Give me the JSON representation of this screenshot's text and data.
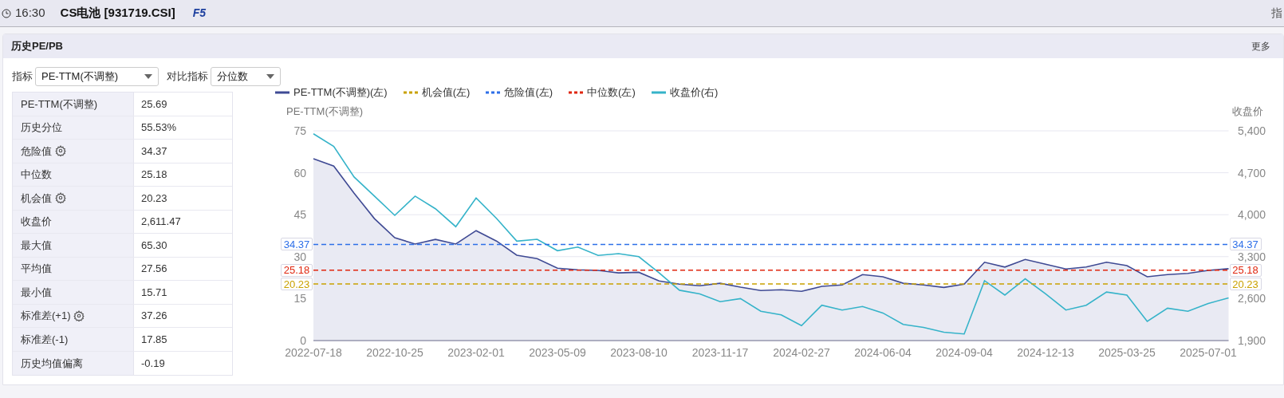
{
  "top_bar": {
    "time": "16:30",
    "title": "CS电池 [931719.CSI]",
    "hotkey": "F5",
    "right_text": "指"
  },
  "panel": {
    "title": "历史PE/PB",
    "more": "更多",
    "controls": [
      {
        "label": "指标",
        "value": "PE-TTM(不调整)"
      },
      {
        "label": "对比指标",
        "value": "分位数"
      }
    ],
    "stats": [
      {
        "name": "PE-TTM(不调整)",
        "value": "25.69",
        "gear": false
      },
      {
        "name": "历史分位",
        "value": "55.53%",
        "gear": false
      },
      {
        "name": "危险值",
        "value": "34.37",
        "gear": true
      },
      {
        "name": "中位数",
        "value": "25.18",
        "gear": false
      },
      {
        "name": "机会值",
        "value": "20.23",
        "gear": true
      },
      {
        "name": "收盘价",
        "value": "2,611.47",
        "gear": false
      },
      {
        "name": "最大值",
        "value": "65.30",
        "gear": false
      },
      {
        "name": "平均值",
        "value": "27.56",
        "gear": false
      },
      {
        "name": "最小值",
        "value": "15.71",
        "gear": false
      },
      {
        "name": "标准差(+1)",
        "value": "37.26",
        "gear": true
      },
      {
        "name": "标准差(-1)",
        "value": "17.85",
        "gear": false
      },
      {
        "name": "历史均值偏离",
        "value": "-0.19",
        "gear": false
      }
    ],
    "chart": {
      "ref_legend": [
        {
          "name": "机会值(左)",
          "color": "#c9a100"
        },
        {
          "name": "危险值(左)",
          "color": "#2d6fe8"
        },
        {
          "name": "中位数(左)",
          "color": "#e0260f"
        }
      ],
      "ref_right_labels": [
        "34.37",
        "25.18",
        "20.23"
      ],
      "chart_data": {
        "type": "line",
        "grid": true,
        "legend": "top",
        "ylabel": "PE-TTM(不调整)",
        "y2label": "收盘价",
        "categories": [
          "2022-07-18",
          null,
          null,
          null,
          "2022-10-25",
          null,
          null,
          null,
          "2023-02-01",
          null,
          null,
          null,
          "2023-05-09",
          null,
          null,
          null,
          "2023-08-10",
          null,
          null,
          null,
          "2023-11-17",
          null,
          null,
          null,
          "2024-02-27",
          null,
          null,
          null,
          "2024-06-04",
          null,
          null,
          null,
          "2024-09-04",
          null,
          null,
          null,
          "2024-12-13",
          null,
          null,
          null,
          "2025-03-25",
          null,
          null,
          null,
          "2025-07-01",
          null
        ],
        "ylim": [
          0,
          75
        ],
        "yticks": [
          0,
          15,
          30,
          45,
          60,
          75
        ],
        "y2lim": [
          1900,
          5400
        ],
        "y2ticks": [
          {
            "value": 1900,
            "label": "1,900"
          },
          {
            "value": 2600,
            "label": "2,600"
          },
          {
            "value": 3300,
            "label": "3,300"
          },
          {
            "value": 4000,
            "label": "4,000"
          },
          {
            "value": 4700,
            "label": "4,700"
          },
          {
            "value": 5400,
            "label": "5,400"
          }
        ],
        "series": [
          {
            "name": "PE-TTM(不调整)(左)",
            "color": "#3f4a94",
            "type": "area",
            "values": [
              65,
              62.4,
              52.7,
              43.6,
              36.8,
              34.5,
              36.2,
              34.5,
              39.3,
              35.6,
              30.5,
              29.3,
              25.9,
              25.3,
              25.1,
              24.2,
              24.4,
              21.3,
              20.2,
              19.6,
              20.5,
              19.1,
              17.9,
              18.2,
              17.6,
              19.4,
              19.9,
              23.6,
              22.8,
              20.5,
              19.9,
              19,
              20.2,
              28,
              26.3,
              29,
              27.3,
              25.6,
              26.3,
              28,
              26.8,
              22.8,
              23.6,
              24,
              25.1,
              25.7
            ]
          },
          {
            "name": "收盘价(右)",
            "color": "#35b3c9",
            "axis": "y2",
            "values": [
              5350,
              5140,
              4630,
              4310,
              3990,
              4310,
              4100,
              3800,
              4280,
              3940,
              3560,
              3590,
              3400,
              3460,
              3320,
              3350,
              3300,
              3030,
              2740,
              2680,
              2550,
              2600,
              2390,
              2330,
              2150,
              2490,
              2410,
              2470,
              2360,
              2170,
              2120,
              2040,
              2010,
              2900,
              2660,
              2930,
              2680,
              2410,
              2490,
              2710,
              2660,
              2220,
              2440,
              2390,
              2520,
              2610
            ]
          }
        ],
        "ref_lines": [
          {
            "axis": "y",
            "value": 34.37,
            "label": "34.37",
            "color": "#2d6fe8"
          },
          {
            "axis": "y",
            "value": 25.18,
            "label": "25.18",
            "color": "#e0260f"
          },
          {
            "axis": "y",
            "value": 20.23,
            "label": "20.23",
            "color": "#c9a100"
          }
        ]
      }
    }
  }
}
